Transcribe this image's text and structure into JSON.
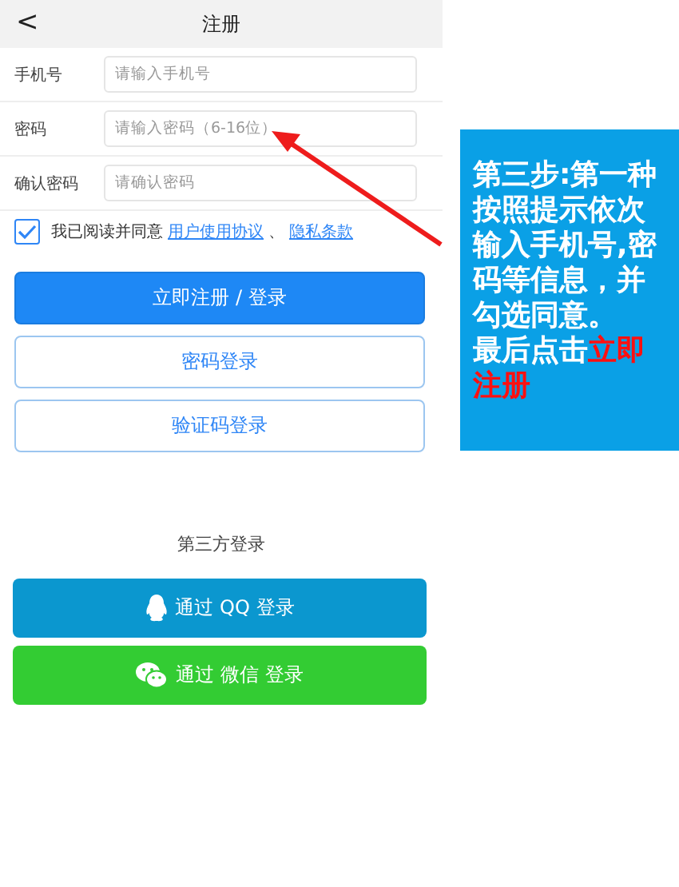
{
  "header": {
    "back": "<",
    "title": "注册"
  },
  "fields": [
    {
      "label": "手机号",
      "placeholder": "请输入手机号"
    },
    {
      "label": "密码",
      "placeholder": "请输入密码（6-16位）"
    },
    {
      "label": "确认密码",
      "placeholder": "请确认密码"
    }
  ],
  "agreement": {
    "checked": true,
    "text": "我已阅读并同意",
    "links": [
      "用户使用协议",
      "隐私条款"
    ],
    "separator": "、"
  },
  "buttons": [
    {
      "label": "立即注册 / 登录",
      "kind": "primary"
    },
    {
      "label": "密码登录",
      "kind": "outline"
    },
    {
      "label": "验证码登录",
      "kind": "outline"
    }
  ],
  "third_party": {
    "title": "第三方登录",
    "buttons": [
      {
        "label": "通过 QQ 登录",
        "kind": "qq"
      },
      {
        "label": "通过 微信 登录",
        "kind": "wechat"
      }
    ]
  },
  "callout": {
    "text": "第三步:第一种按照提示依次输入手机号,密码等信息，并勾选同意。",
    "prefix": "最后点击",
    "highlight": "立即注册"
  }
}
